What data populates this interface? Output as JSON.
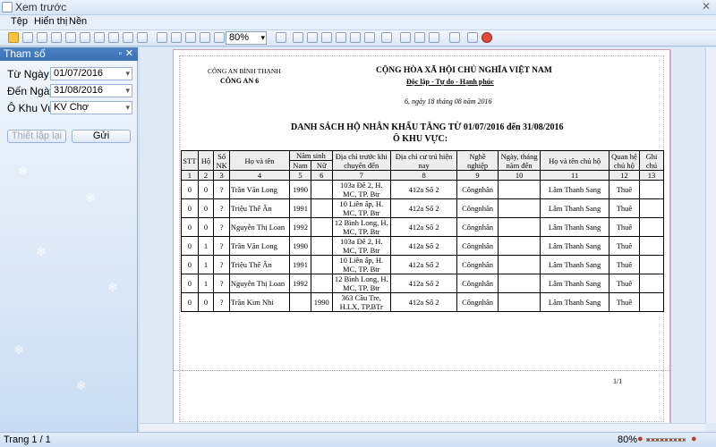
{
  "window": {
    "title": "Xem trước"
  },
  "menu": [
    "Tệp",
    "Hiển thị",
    "Nền"
  ],
  "toolbar": {
    "zoom": "80%"
  },
  "params": {
    "title": "Tham số",
    "from_label": "Từ Ngày",
    "from_value": "01/07/2016",
    "to_label": "Đến Ngày",
    "to_value": "31/08/2016",
    "area_label": "Ô Khu Vực",
    "area_value": "KV Chợ",
    "setup_button": "Thiết lập lại",
    "send_button": "Gửi"
  },
  "report": {
    "agency_top": "CÔNG AN BÌNH THẠNH",
    "agency": "CÔNG AN 6",
    "nation": "CỘNG HÒA XÃ HỘI CHỦ NGHĨA VIỆT NAM",
    "motto": "Độc lập - Tự do - Hạnh phúc",
    "date": "6, ngày 18 tháng 08 năm 2016",
    "title": "DANH SÁCH HỘ NHÂN KHẨU TĂNG TỪ 01/07/2016 đến 31/08/2016",
    "subtitle": "Ô KHU VỰC:",
    "headers": {
      "stt": "STT",
      "ho": "Hộ",
      "sonk": "Số NK",
      "hoten": "Họ và tên",
      "namsinh": "Năm sinh",
      "nam": "Nam",
      "nu": "Nữ",
      "diachitruoc": "Địa chỉ trước khi chuyển đến",
      "diachicutru": "Địa chỉ cư trú hiện nay",
      "nghe": "Nghề nghiệp",
      "ngay": "Ngày, tháng năm đến",
      "chuho": "Họ và tên chủ hộ",
      "quanhe": "Quan hệ chủ hộ",
      "ghichu": "Ghi chú"
    },
    "colnums": [
      "1",
      "2",
      "3",
      "4",
      "5",
      "6",
      "7",
      "8",
      "9",
      "10",
      "11",
      "12",
      "13"
    ],
    "rows": [
      {
        "stt": "0",
        "ho": "0",
        "sonk": "?",
        "name": "Trần Văn Long",
        "nam": "1990",
        "nu": "",
        "prev": "103a Đê 2, H. MC, TP. Btr",
        "cur": "412a Số 2",
        "job": "Côngnhân",
        "date": "",
        "head": "Lâm Thanh Sang",
        "rel": "Thuê",
        "note": ""
      },
      {
        "stt": "0",
        "ho": "0",
        "sonk": "?",
        "name": "Triệu Thế Ân",
        "nam": "1991",
        "nu": "",
        "prev": "10 Liên ấp, H. MC, TP. Btr",
        "cur": "412a Số 2",
        "job": "Côngnhân",
        "date": "",
        "head": "Lâm Thanh Sang",
        "rel": "Thuê",
        "note": ""
      },
      {
        "stt": "0",
        "ho": "0",
        "sonk": "?",
        "name": "Nguyễn Thị Loan",
        "nam": "1992",
        "nu": "",
        "prev": "12 Bình Long, H. MC, TP. Btr",
        "cur": "412a Số 2",
        "job": "Côngnhân",
        "date": "",
        "head": "Lâm Thanh Sang",
        "rel": "Thuê",
        "note": ""
      },
      {
        "stt": "0",
        "ho": "1",
        "sonk": "?",
        "name": "Trần Văn Long",
        "nam": "1990",
        "nu": "",
        "prev": "103a Đê 2, H. MC, TP. Btr",
        "cur": "412a Số 2",
        "job": "Côngnhân",
        "date": "",
        "head": "Lâm Thanh Sang",
        "rel": "Thuê",
        "note": ""
      },
      {
        "stt": "0",
        "ho": "1",
        "sonk": "?",
        "name": "Triệu Thế Ân",
        "nam": "1991",
        "nu": "",
        "prev": "10 Liên ấp, H. MC, TP. Btr",
        "cur": "412a Số 2",
        "job": "Côngnhân",
        "date": "",
        "head": "Lâm Thanh Sang",
        "rel": "Thuê",
        "note": ""
      },
      {
        "stt": "0",
        "ho": "1",
        "sonk": "?",
        "name": "Nguyễn Thị Loan",
        "nam": "1992",
        "nu": "",
        "prev": "12 Bình Long, H. MC, TP. Btr",
        "cur": "412a Số 2",
        "job": "Côngnhân",
        "date": "",
        "head": "Lâm Thanh Sang",
        "rel": "Thuê",
        "note": ""
      },
      {
        "stt": "0",
        "ho": "0",
        "sonk": "?",
        "name": "Trần Kim Nhi",
        "nam": "",
        "nu": "1990",
        "prev": "363 Cầu Tre, H.LX, TP.BTr",
        "cur": "412a Số 2",
        "job": "Côngnhân",
        "date": "",
        "head": "Lâm Thanh Sang",
        "rel": "Thuê",
        "note": ""
      }
    ],
    "page_num": "1/1"
  },
  "status": {
    "page": "Trang 1 / 1",
    "zoom": "80%"
  }
}
